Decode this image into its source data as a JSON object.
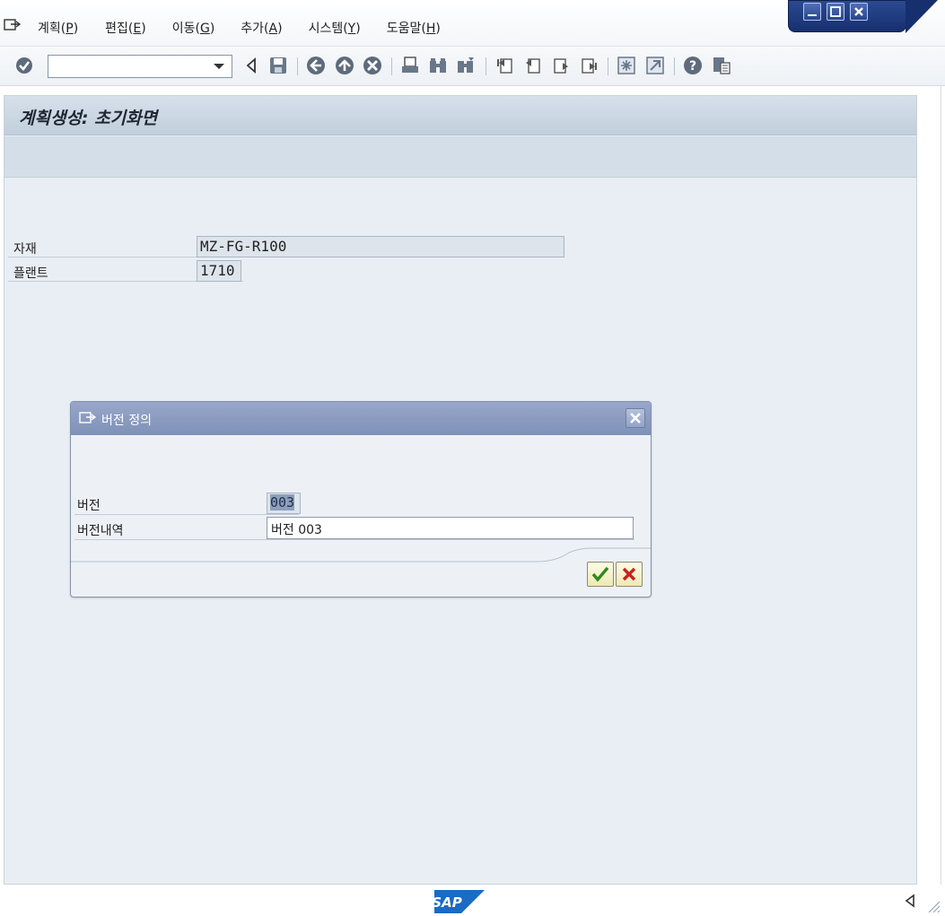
{
  "menu": {
    "items": [
      {
        "pre": "계획(",
        "acc": "P",
        "post": ")"
      },
      {
        "pre": "편집(",
        "acc": "E",
        "post": ")"
      },
      {
        "pre": "이동(",
        "acc": "G",
        "post": ")"
      },
      {
        "pre": "추가(",
        "acc": "A",
        "post": ")"
      },
      {
        "pre": "시스템(",
        "acc": "Y",
        "post": ")"
      },
      {
        "pre": "도움말(",
        "acc": "H",
        "post": ")"
      }
    ]
  },
  "toolbar": {
    "command_field_value": "",
    "icons": [
      "enter-icon",
      "back-arrow-icon",
      "save-icon",
      "back-icon",
      "exit-icon",
      "cancel-icon",
      "print-icon",
      "find-icon",
      "find-next-icon",
      "first-page-icon",
      "previous-page-icon",
      "next-page-icon",
      "last-page-icon",
      "create-session-icon",
      "shortcut-icon",
      "help-icon",
      "customize-layout-icon"
    ]
  },
  "screen": {
    "title": "계획생성: 초기화면",
    "fields": {
      "material_label": "자재",
      "material_value": "MZ-FG-R100",
      "plant_label": "플랜트",
      "plant_value": "1710"
    }
  },
  "dialog": {
    "title": "버전 정의",
    "version_label": "버전",
    "version_value": "003",
    "description_label": "버전내역",
    "description_value": "버전 003"
  },
  "status": {
    "logo_text": "SAP"
  },
  "colors": {
    "title_bar": "#c8d5e1",
    "dialog_header": "#8a9bc0",
    "window_controls": "#1f3a80",
    "confirm_green": "#2f8a1a",
    "cancel_red": "#c8201c",
    "sap_logo_blue": "#1a6bc4"
  }
}
